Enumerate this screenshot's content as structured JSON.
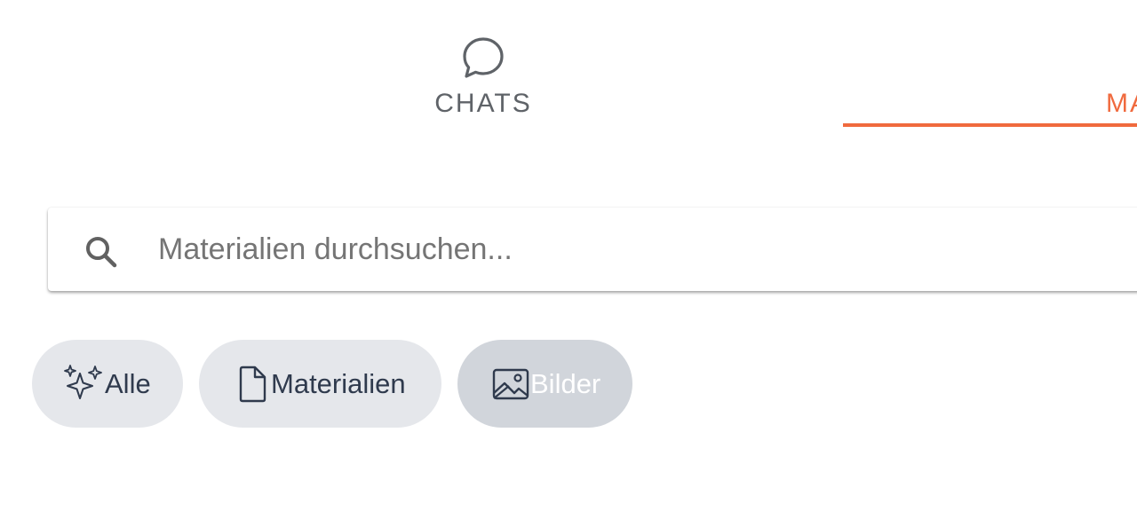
{
  "tabs": {
    "chats": {
      "label": "CHATS",
      "icon": "chat-bubble-icon"
    },
    "materials": {
      "label": "MA",
      "icon": "none",
      "active": true
    }
  },
  "search": {
    "placeholder": "Materialien durchsuchen...",
    "value": "",
    "icon": "search-icon"
  },
  "filters": [
    {
      "label": "Alle",
      "icon": "sparkles-icon",
      "selected": false
    },
    {
      "label": "Materialien",
      "icon": "document-icon",
      "selected": false
    },
    {
      "label": "Bilder",
      "icon": "image-icon",
      "selected": true
    }
  ],
  "colors": {
    "accent": "#f06a3e",
    "tab_text": "#5f6368",
    "chip_bg": "#e5e7eb",
    "chip_selected_bg": "#d1d5db",
    "chip_text": "#2f3a4d",
    "chip_selected_text": "#ffffff"
  }
}
